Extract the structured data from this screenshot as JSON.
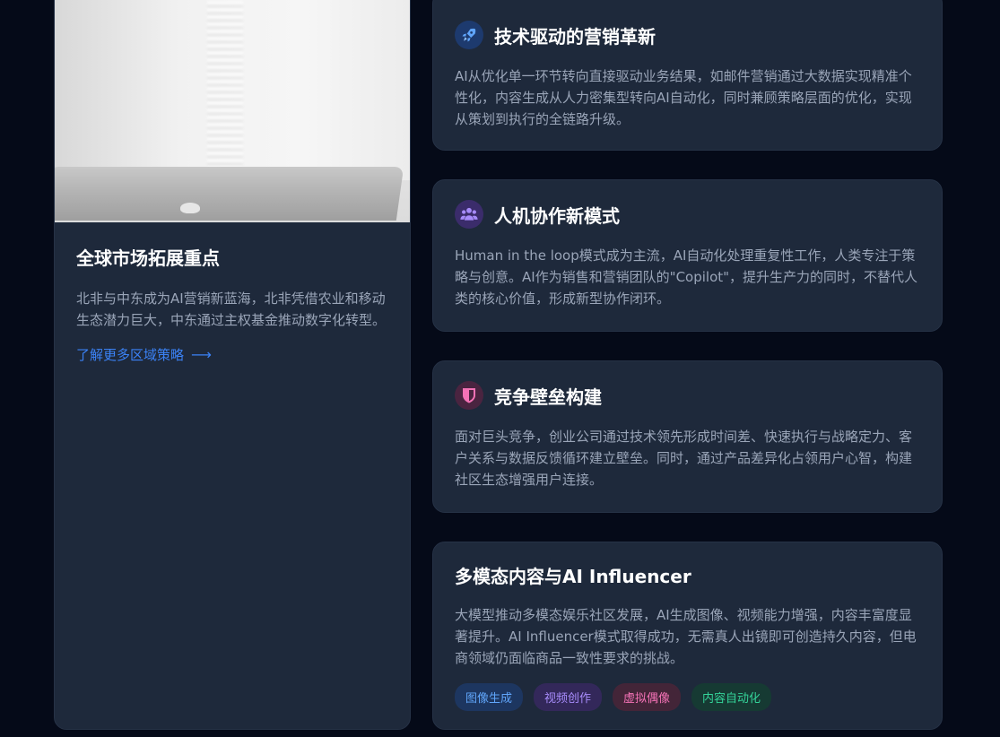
{
  "left_card": {
    "title": "全球市场拓展重点",
    "description": "北非与中东成为AI营销新蓝海，北非凭借农业和移动生态潜力巨大，中东通过主权基金推动数字化转型。",
    "link_label": "了解更多区域策略",
    "link_arrow": "⟶"
  },
  "cards": [
    {
      "icon": "rocket-icon",
      "title": "技术驱动的营销革新",
      "description": "AI从优化单一环节转向直接驱动业务结果，如邮件营销通过大数据实现精准个性化，内容生成从人力密集型转向AI自动化，同时兼顾策略层面的优化，实现从策划到执行的全链路升级。"
    },
    {
      "icon": "users-icon",
      "title": "人机协作新模式",
      "description": "Human in the loop模式成为主流，AI自动化处理重复性工作，人类专注于策略与创意。AI作为销售和营销团队的\"Copilot\"，提升生产力的同时，不替代人类的核心价值，形成新型协作闭环。"
    },
    {
      "icon": "shield-icon",
      "title": "竞争壁垒构建",
      "description": "面对巨头竞争，创业公司通过技术领先形成时间差、快速执行与战略定力、客户关系与数据反馈循环建立壁垒。同时，通过产品差异化占领用户心智，构建社区生态增强用户连接。"
    },
    {
      "title": "多模态内容与AI Influencer",
      "description": "大模型推动多模态娱乐社区发展，AI生成图像、视频能力增强，内容丰富度显著提升。AI Influencer模式取得成功，无需真人出镜即可创造持久内容，但电商领域仍面临商品一致性要求的挑战。",
      "tags": [
        "图像生成",
        "视频创作",
        "虚拟偶像",
        "内容自动化"
      ]
    }
  ],
  "colors": {
    "background": "#050a18",
    "card": "#1e293b",
    "link": "#3b82f6"
  }
}
